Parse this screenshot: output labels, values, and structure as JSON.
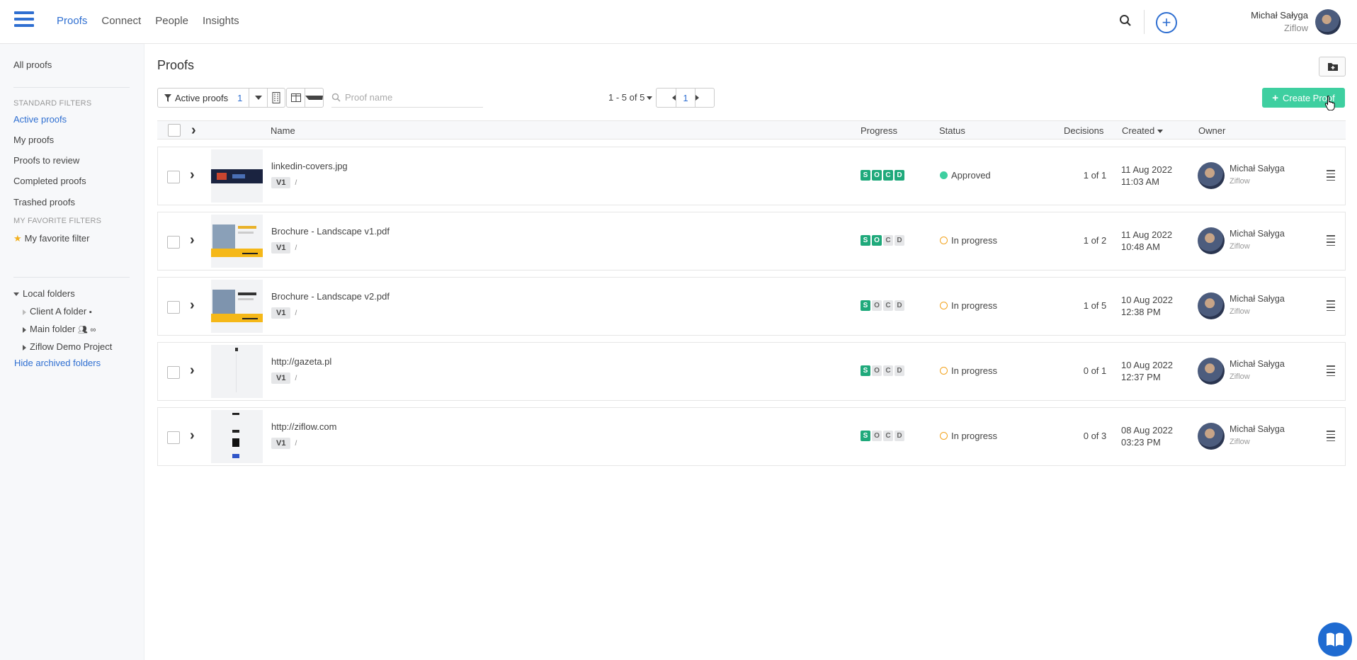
{
  "nav": {
    "items": [
      {
        "label": "Proofs",
        "active": true
      },
      {
        "label": "Connect",
        "active": false
      },
      {
        "label": "People",
        "active": false
      },
      {
        "label": "Insights",
        "active": false
      }
    ]
  },
  "user": {
    "name": "Michał Sałyga",
    "org": "Ziflow"
  },
  "sidebar": {
    "all_proofs": "All proofs",
    "standard_filters_heading": "STANDARD FILTERS",
    "standard_filters": [
      "Active proofs",
      "My proofs",
      "Proofs to review",
      "Completed proofs",
      "Trashed proofs"
    ],
    "favorite_heading": "MY FAVORITE FILTERS",
    "favorite_filter": "My favorite filter",
    "local_folders": "Local folders",
    "folders": [
      "Client A folder",
      "Main folder",
      "Ziflow Demo Project"
    ],
    "hide_archived": "Hide archived folders"
  },
  "page": {
    "title": "Proofs",
    "filter_label": "Active proofs",
    "filter_count": "1",
    "search_placeholder": "Proof name",
    "pager_range": "1 - 5 of 5",
    "current_page": "1",
    "create_label": "Create Proof"
  },
  "table": {
    "columns": {
      "name": "Name",
      "progress": "Progress",
      "status": "Status",
      "decisions": "Decisions",
      "created": "Created",
      "owner": "Owner"
    },
    "rows": [
      {
        "name": "linkedin-covers.jpg",
        "version": "V1",
        "stages": [
          "S",
          "O",
          "C",
          "D"
        ],
        "done": [
          true,
          true,
          true,
          true
        ],
        "status": "Approved",
        "decisions": "1 of 1",
        "date": "11 Aug 2022",
        "time": "11:03 AM",
        "owner": "Michał Sałyga",
        "owner_org": "Ziflow"
      },
      {
        "name": "Brochure - Landscape v1.pdf",
        "version": "V1",
        "stages": [
          "S",
          "O",
          "C",
          "D"
        ],
        "done": [
          true,
          true,
          false,
          false
        ],
        "status": "In progress",
        "decisions": "1 of 2",
        "date": "11 Aug 2022",
        "time": "10:48 AM",
        "owner": "Michał Sałyga",
        "owner_org": "Ziflow"
      },
      {
        "name": "Brochure - Landscape v2.pdf",
        "version": "V1",
        "stages": [
          "S",
          "O",
          "C",
          "D"
        ],
        "done": [
          true,
          false,
          false,
          false
        ],
        "status": "In progress",
        "decisions": "1 of 5",
        "date": "10 Aug 2022",
        "time": "12:38 PM",
        "owner": "Michał Sałyga",
        "owner_org": "Ziflow"
      },
      {
        "name": "http://gazeta.pl",
        "version": "V1",
        "stages": [
          "S",
          "O",
          "C",
          "D"
        ],
        "done": [
          true,
          false,
          false,
          false
        ],
        "status": "In progress",
        "decisions": "0 of 1",
        "date": "10 Aug 2022",
        "time": "12:37 PM",
        "owner": "Michał Sałyga",
        "owner_org": "Ziflow"
      },
      {
        "name": "http://ziflow.com",
        "version": "V1",
        "stages": [
          "S",
          "O",
          "C",
          "D"
        ],
        "done": [
          true,
          false,
          false,
          false
        ],
        "status": "In progress",
        "decisions": "0 of 3",
        "date": "08 Aug 2022",
        "time": "03:23 PM",
        "owner": "Michał Sałyga",
        "owner_org": "Ziflow"
      }
    ]
  },
  "colors": {
    "accent": "#2f6fd1",
    "create_button": "#3ecfa0",
    "stage_done": "#1fa97b",
    "in_progress": "#f2a31e"
  }
}
